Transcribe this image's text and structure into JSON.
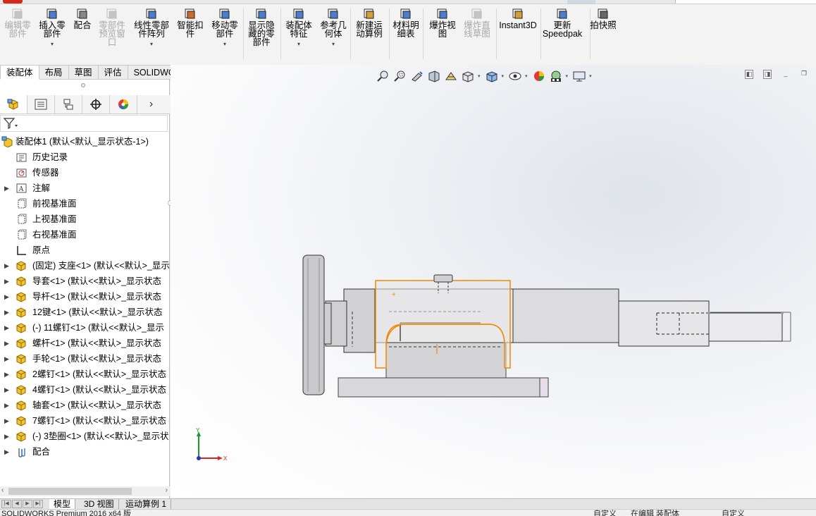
{
  "commands": [
    {
      "id": "edit-component",
      "label": [
        "编辑零",
        "部件"
      ],
      "icon": "edit-component-icon",
      "enabled": false,
      "caret": false
    },
    {
      "id": "insert-component",
      "label": [
        "插入零",
        "部件"
      ],
      "icon": "insert-component-icon",
      "enabled": true,
      "caret": true
    },
    {
      "id": "mate",
      "label": [
        "配合"
      ],
      "icon": "paperclip-mate-icon",
      "enabled": true,
      "caret": false
    },
    {
      "id": "component-preview",
      "label": [
        "零部件",
        "预览窗",
        "口"
      ],
      "icon": "preview-window-icon",
      "enabled": false,
      "caret": false
    },
    {
      "id": "linear-pattern",
      "label": [
        "线性零部",
        "件阵列"
      ],
      "icon": "linear-pattern-icon",
      "enabled": true,
      "caret": true
    },
    {
      "id": "smart-fasteners",
      "label": [
        "智能扣",
        "件"
      ],
      "icon": "smart-fasteners-icon",
      "enabled": true,
      "caret": false
    },
    {
      "id": "move-component",
      "label": [
        "移动零",
        "部件"
      ],
      "icon": "move-component-icon",
      "enabled": true,
      "caret": true
    },
    {
      "id": "show-hidden",
      "label": [
        "显示隐",
        "藏的零",
        "部件"
      ],
      "icon": "show-hidden-icon",
      "enabled": true,
      "caret": false
    },
    {
      "id": "assembly-features",
      "label": [
        "装配体",
        "特征"
      ],
      "icon": "assembly-features-icon",
      "enabled": true,
      "caret": true
    },
    {
      "id": "reference-geometry",
      "label": [
        "参考几",
        "何体"
      ],
      "icon": "reference-geometry-icon",
      "enabled": true,
      "caret": true
    },
    {
      "id": "new-motion-study",
      "label": [
        "新建运",
        "动算例"
      ],
      "icon": "motion-study-icon",
      "enabled": true,
      "caret": false
    },
    {
      "id": "bom",
      "label": [
        "材料明",
        "细表"
      ],
      "icon": "bom-icon",
      "enabled": true,
      "caret": false
    },
    {
      "id": "exploded-view",
      "label": [
        "爆炸视",
        "图"
      ],
      "icon": "exploded-view-icon",
      "enabled": true,
      "caret": false
    },
    {
      "id": "explode-line",
      "label": [
        "爆炸直",
        "线草图"
      ],
      "icon": "explode-line-icon",
      "enabled": false,
      "caret": false
    },
    {
      "id": "instant3d",
      "label": [
        "Instant3D"
      ],
      "icon": "instant3d-icon",
      "enabled": true,
      "caret": false
    },
    {
      "id": "update-speedpak",
      "label": [
        "更新",
        "Speedpak"
      ],
      "icon": "speedpak-icon",
      "enabled": true,
      "caret": false
    },
    {
      "id": "snapshot",
      "label": [
        "拍快照"
      ],
      "icon": "camera-icon",
      "enabled": true,
      "caret": false
    }
  ],
  "tabs": [
    "装配体",
    "布局",
    "草图",
    "评估",
    "SOLIDWORKS 插件"
  ],
  "active_tab": 0,
  "tree": {
    "root": "装配体1  (默认<默认_显示状态-1>)",
    "fixed_items": [
      {
        "label": "历史记录",
        "icon": "history-folder-icon"
      },
      {
        "label": "传感器",
        "icon": "sensor-icon"
      },
      {
        "label": "注解",
        "icon": "annotation-icon"
      },
      {
        "label": "前视基准面",
        "icon": "plane-icon"
      },
      {
        "label": "上视基准面",
        "icon": "plane-icon"
      },
      {
        "label": "右视基准面",
        "icon": "plane-icon"
      },
      {
        "label": "原点",
        "icon": "origin-icon"
      }
    ],
    "components": [
      "(固定) 支座<1> (默认<<默认>_显示",
      "导套<1> (默认<<默认>_显示状态",
      "导杆<1> (默认<<默认>_显示状态",
      "12键<1> (默认<<默认>_显示状态",
      "(-) 11螺钉<1> (默认<<默认>_显示",
      "螺杆<1> (默认<<默认>_显示状态",
      "手轮<1> (默认<<默认>_显示状态",
      "2螺钉<1> (默认<<默认>_显示状态",
      "4螺钉<1> (默认<<默认>_显示状态",
      "轴套<1> (默认<<默认>_显示状态",
      "7螺钉<1> (默认<<默认>_显示状态",
      "(-) 3垫圈<1> (默认<<默认>_显示状"
    ],
    "mates": "配合"
  },
  "bottom_tabs": [
    "模型",
    "3D 视图",
    "运动算例 1"
  ],
  "active_bottom_tab": 0,
  "status": {
    "left": "SOLIDWORKS Premium 2016 x64 版",
    "custom1": "自定义",
    "editing": "在编辑 装配体",
    "custom2": "自定义"
  },
  "triad": {
    "x_label": "X",
    "y_label": "Y"
  },
  "colors": {
    "accent_part": "#e5a400",
    "selection": "#f08a00",
    "x_axis": "#d22",
    "y_axis": "#1a9a2a",
    "z_axis": "#2233cc"
  }
}
